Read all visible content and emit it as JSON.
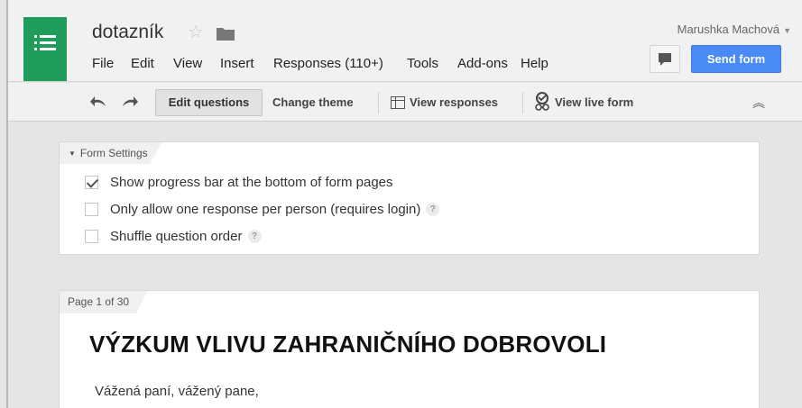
{
  "header": {
    "doc_title": "dotazník",
    "user_name": "Marushka Machová",
    "send_button": "Send form",
    "menu": [
      "File",
      "Edit",
      "View",
      "Insert",
      "Responses (110+)",
      "Tools",
      "Add-ons",
      "Help"
    ]
  },
  "toolbar": {
    "edit_questions": "Edit questions",
    "change_theme": "Change theme",
    "view_responses": "View responses",
    "view_live_form": "View live form"
  },
  "settings": {
    "tab_label": "Form Settings",
    "options": [
      {
        "label": "Show progress bar at the bottom of form pages",
        "checked": true
      },
      {
        "label": "Only allow one response per person (requires login)",
        "checked": false
      },
      {
        "label": "Shuffle question order",
        "checked": false
      }
    ],
    "help_glyph": "?"
  },
  "page": {
    "indicator": "Page 1 of 30",
    "form_title": "VÝZKUM VLIVU ZAHRANIČNÍHO DOBROVOLI",
    "description": "Vážená paní, vážený pane,"
  },
  "colors": {
    "logo_green": "#1e9e5a",
    "send_blue": "#4a8af4"
  }
}
